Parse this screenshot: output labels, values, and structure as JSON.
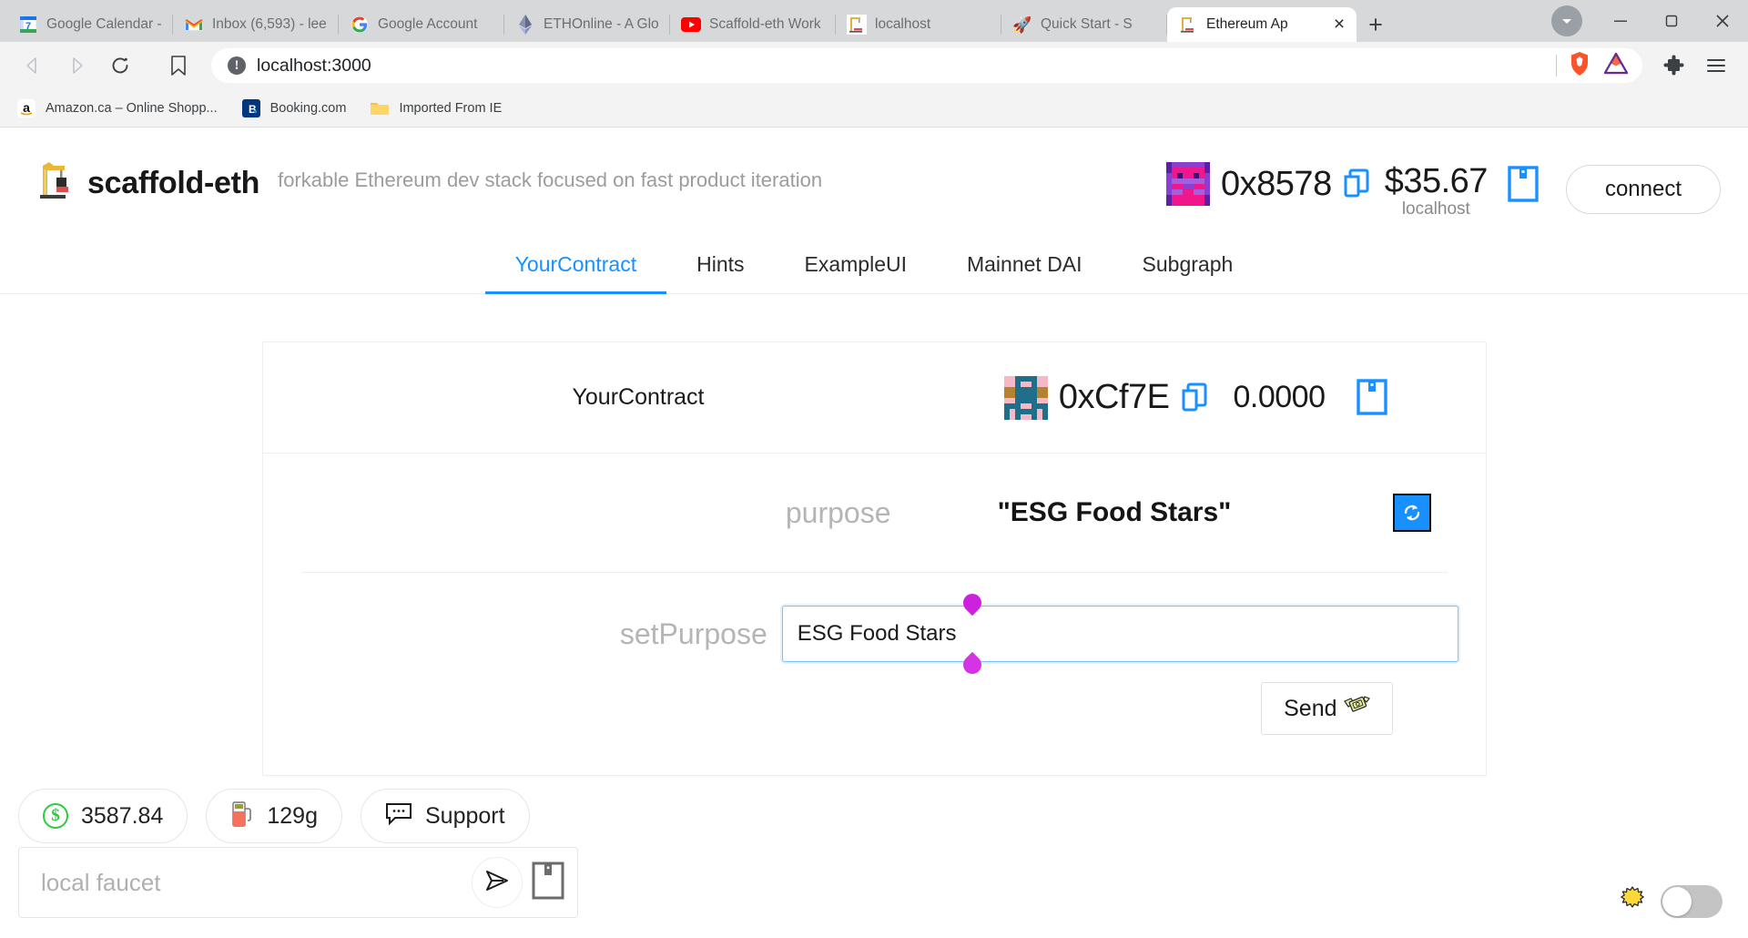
{
  "browser": {
    "tabs": [
      {
        "title": "Google Calendar -",
        "icon": "google-calendar-icon",
        "active": false
      },
      {
        "title": "Inbox (6,593) - lee",
        "icon": "gmail-icon",
        "active": false
      },
      {
        "title": "Google Account",
        "icon": "google-icon",
        "active": false
      },
      {
        "title": "ETHOnline - A Glo",
        "icon": "ethereum-icon",
        "active": false
      },
      {
        "title": "Scaffold-eth Work",
        "icon": "youtube-icon",
        "active": false
      },
      {
        "title": "localhost",
        "icon": "scaffold-eth-icon",
        "active": false
      },
      {
        "title": "Quick Start - S",
        "icon": "rocket-icon",
        "active": false
      },
      {
        "title": "Ethereum Ap",
        "icon": "scaffold-eth-icon",
        "active": true
      }
    ],
    "new_tab_label": "+",
    "close_tab_label": "×",
    "window_controls": {
      "minimize": "—",
      "maximize": "❐",
      "close": "✕",
      "profile": "▼"
    },
    "nav": {
      "back": "back-arrow",
      "forward": "forward-arrow",
      "reload": "reload-arrow",
      "bookmark": "bookmark-outline"
    },
    "address_bar": {
      "security_label": "!",
      "url": "localhost:3000",
      "shield_icon": "brave-lion-shield",
      "rewards_icon": "brave-rewards-triangle"
    },
    "toolbar": {
      "extensions": "puzzle-piece",
      "menu": "hamburger-menu"
    },
    "bookmarks": [
      {
        "label": "Amazon.ca – Online Shopp...",
        "icon": "amazon-icon"
      },
      {
        "label": "Booking.com",
        "icon": "booking-icon"
      },
      {
        "label": "Imported From IE",
        "icon": "folder-icon"
      }
    ]
  },
  "app": {
    "brand": {
      "logo_icon": "construction-crane-icon",
      "name": "scaffold-eth",
      "tagline": "forkable Ethereum dev stack focused on fast product iteration"
    },
    "account": {
      "avatar_icon": "blockie-avatar",
      "address": "0x8578",
      "copy_icon": "copy-icon",
      "balance": "$35.67",
      "network": "localhost",
      "qr_icon": "qr-code-icon",
      "connect_label": "connect"
    },
    "nav_tabs": [
      {
        "label": "YourContract",
        "active": true
      },
      {
        "label": "Hints",
        "active": false
      },
      {
        "label": "ExampleUI",
        "active": false
      },
      {
        "label": "Mainnet DAI",
        "active": false
      },
      {
        "label": "Subgraph",
        "active": false
      }
    ],
    "contract": {
      "title": "YourContract",
      "avatar_icon": "blockie-avatar",
      "address": "0xCf7E",
      "copy_icon": "copy-icon",
      "balance": "0.0000",
      "qr_icon": "qr-code-icon",
      "purpose_label": "purpose",
      "purpose_value": "\"ESG Food Stars\"",
      "refresh_icon": "refresh-icon",
      "set_purpose_label": "setPurpose",
      "set_purpose_value": "ESG Food Stars",
      "set_purpose_placeholder": "",
      "send_label": "Send",
      "send_icon": "money-with-wings-icon"
    },
    "widgets": {
      "price_icon": "dollar-circle-icon",
      "price": "3587.84",
      "gas_icon": "fuel-pump-icon",
      "gas": "129g",
      "support_icon": "chat-bubble-icon",
      "support_label": "Support",
      "faucet_placeholder": "local faucet",
      "faucet_value": "",
      "faucet_send_icon": "paper-plane-icon",
      "faucet_qr_icon": "qr-code-icon"
    },
    "theme": {
      "sun_icon": "sun-icon",
      "toggle_state": "off"
    },
    "colors": {
      "accent": "#1890ff",
      "muted": "#b5b5b5",
      "text": "#1a1a1a",
      "selection_handle": "#cc22dd",
      "green": "#2ecb3f"
    }
  }
}
